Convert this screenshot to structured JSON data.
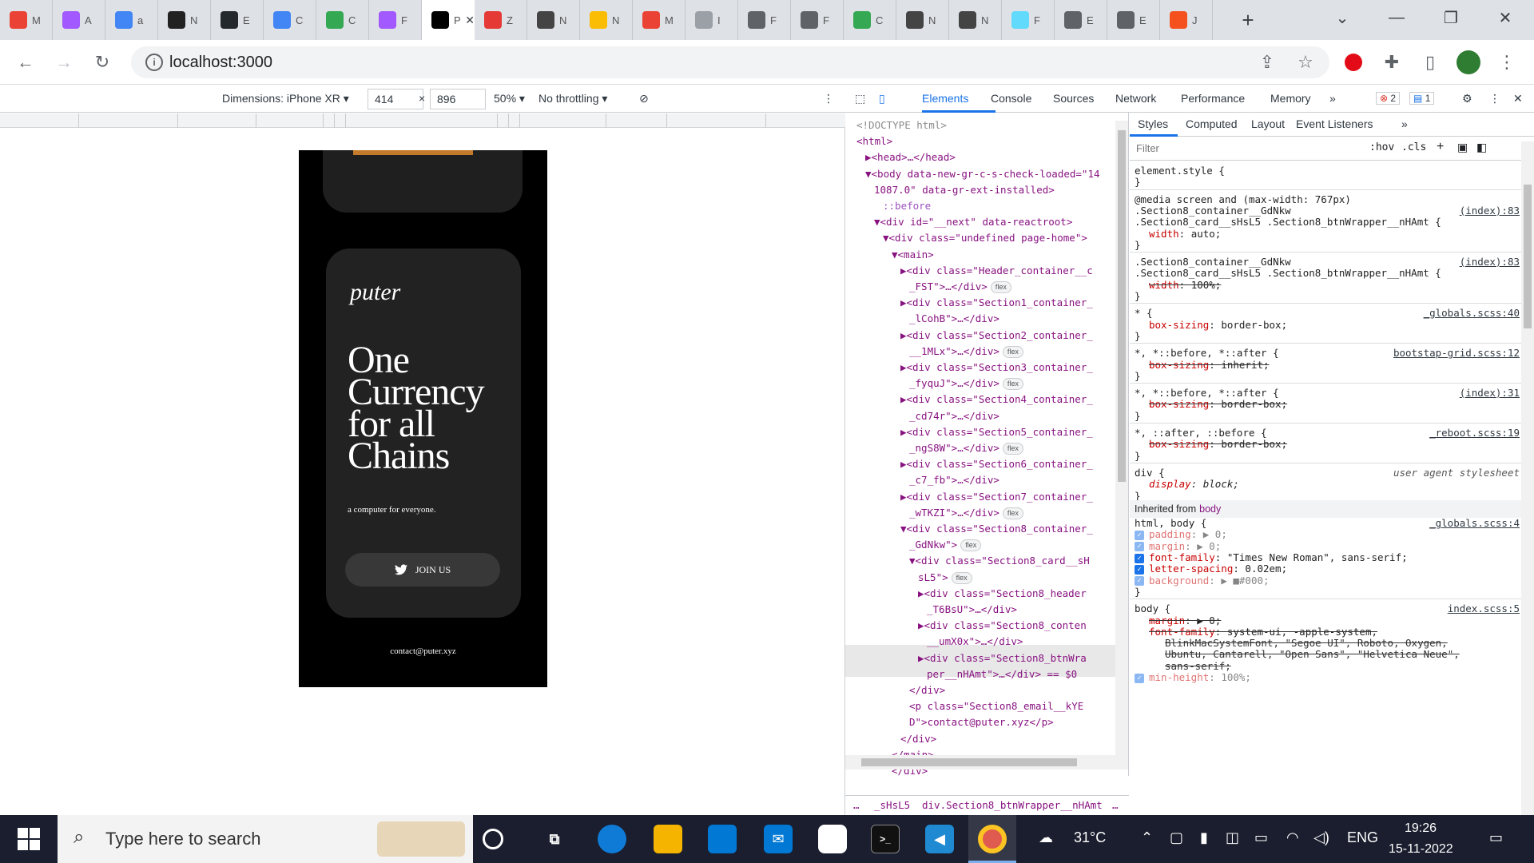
{
  "browser": {
    "tabs": [
      {
        "letter": "M",
        "color": "#ea4335"
      },
      {
        "letter": "A",
        "color": "#a259ff"
      },
      {
        "letter": "a",
        "color": "#4285f4"
      },
      {
        "letter": "N",
        "color": "#222222"
      },
      {
        "letter": "E",
        "color": "#24292e"
      },
      {
        "letter": "C",
        "color": "#4285f4"
      },
      {
        "letter": "C",
        "color": "#34a853"
      },
      {
        "letter": "F",
        "color": "#a259ff"
      },
      {
        "letter": "P",
        "color": "#000000",
        "active": true
      },
      {
        "letter": "Z",
        "color": "#e53935"
      },
      {
        "letter": "N",
        "color": "#444444"
      },
      {
        "letter": "N",
        "color": "#fbbc04"
      },
      {
        "letter": "M",
        "color": "#ea4335"
      },
      {
        "letter": "I",
        "color": "#9aa0a6"
      },
      {
        "letter": "F",
        "color": "#5f6368"
      },
      {
        "letter": "F",
        "color": "#5f6368"
      },
      {
        "letter": "C",
        "color": "#34a853"
      },
      {
        "letter": "N",
        "color": "#444444"
      },
      {
        "letter": "N",
        "color": "#444444"
      },
      {
        "letter": "F",
        "color": "#61dafb"
      },
      {
        "letter": "E",
        "color": "#5f6368"
      },
      {
        "letter": "E",
        "color": "#5f6368"
      },
      {
        "letter": "J",
        "color": "#f4511e"
      }
    ],
    "active_tab_letter": "P",
    "url": "localhost:3000"
  },
  "device_toolbar": {
    "dimensions_label": "Dimensions: iPhone XR",
    "width": "414",
    "times": "×",
    "height": "896",
    "zoom": "50%",
    "throttling": "No throttling"
  },
  "site": {
    "logo": "puter",
    "headline": "One Currency for all Chains",
    "tagline": "a computer for everyone.",
    "join_label": "JOIN US",
    "contact": "contact@puter.xyz"
  },
  "devtools": {
    "tabs": [
      "Elements",
      "Console",
      "Sources",
      "Network",
      "Performance",
      "Memory"
    ],
    "more": "»",
    "errors": "2",
    "messages": "1",
    "styles_tabs": [
      "Styles",
      "Computed",
      "Layout",
      "Event Listeners"
    ],
    "filter_placeholder": "Filter",
    "hov": ":hov",
    "cls": ".cls",
    "breadcrumbs": [
      "…",
      "_sHsL5",
      "div.Section8_btnWrapper__nHAmt",
      "…"
    ],
    "dom": [
      {
        "indent": 0,
        "text": "<!DOCTYPE html>",
        "cls": "cm"
      },
      {
        "indent": 0,
        "text": "<html>"
      },
      {
        "indent": 1,
        "text": "▶<head>…</head>"
      },
      {
        "indent": 1,
        "text": "▼<body data-new-gr-c-s-check-loaded=\"14"
      },
      {
        "indent": 2,
        "text": "1087.0\" data-gr-ext-installed>"
      },
      {
        "indent": 3,
        "text": "::before",
        "cls": "pseudo"
      },
      {
        "indent": 2,
        "text": "▼<div id=\"__next\" data-reactroot>"
      },
      {
        "indent": 3,
        "text": "▼<div class=\"undefined page-home\">"
      },
      {
        "indent": 4,
        "text": "▼<main>"
      },
      {
        "indent": 5,
        "text": "▶<div class=\"Header_container__c"
      },
      {
        "indent": 6,
        "text": "_FST\">…</div>",
        "badge": "flex"
      },
      {
        "indent": 5,
        "text": "▶<div class=\"Section1_container_"
      },
      {
        "indent": 6,
        "text": "_lCohB\">…</div>"
      },
      {
        "indent": 5,
        "text": "▶<div class=\"Section2_container_"
      },
      {
        "indent": 6,
        "text": "__1MLx\">…</div>",
        "badge": "flex"
      },
      {
        "indent": 5,
        "text": "▶<div class=\"Section3_container_"
      },
      {
        "indent": 6,
        "text": "_fyquJ\">…</div>",
        "badge": "flex"
      },
      {
        "indent": 5,
        "text": "▶<div class=\"Section4_container_"
      },
      {
        "indent": 6,
        "text": "_cd74r\">…</div>"
      },
      {
        "indent": 5,
        "text": "▶<div class=\"Section5_container_"
      },
      {
        "indent": 6,
        "text": "_ngS8W\">…</div>",
        "badge": "flex"
      },
      {
        "indent": 5,
        "text": "▶<div class=\"Section6_container_"
      },
      {
        "indent": 6,
        "text": "_c7_fb\">…</div>"
      },
      {
        "indent": 5,
        "text": "▶<div class=\"Section7_container_"
      },
      {
        "indent": 6,
        "text": "_wTKZI\">…</div>",
        "badge": "flex"
      },
      {
        "indent": 5,
        "text": "▼<div class=\"Section8_container_"
      },
      {
        "indent": 6,
        "text": "_GdNkw\">",
        "badge": "flex"
      },
      {
        "indent": 6,
        "text": "▼<div class=\"Section8_card__sH"
      },
      {
        "indent": 7,
        "text": "sL5\">",
        "badge": "flex"
      },
      {
        "indent": 7,
        "text": "▶<div class=\"Section8_header"
      },
      {
        "indent": 8,
        "text": "_T6BsU\">…</div>"
      },
      {
        "indent": 7,
        "text": "▶<div class=\"Section8_conten"
      },
      {
        "indent": 8,
        "text": "__umX0x\">…</div>"
      },
      {
        "indent": 7,
        "text": "▶<div class=\"Section8_btnWra"
      },
      {
        "indent": 8,
        "text": "per__nHAmt\">…</div> == $0"
      },
      {
        "indent": 6,
        "text": "</div>"
      },
      {
        "indent": 6,
        "text": "<p class=\"Section8_email__kYE"
      },
      {
        "indent": 6,
        "text": "D\">contact@puter.xyz</p>"
      },
      {
        "indent": 5,
        "text": "</div>"
      },
      {
        "indent": 4,
        "text": "</main>"
      },
      {
        "indent": 4,
        "text": "</div>"
      }
    ],
    "styles": [
      {
        "kind": "sel",
        "text": "element.style {"
      },
      {
        "kind": "close",
        "text": "}"
      },
      {
        "kind": "sep"
      },
      {
        "kind": "sel",
        "text": "@media screen and (max-width: 767px)"
      },
      {
        "kind": "selsrc",
        "text": ".Section8_container__GdNkw",
        "src": "(index):83"
      },
      {
        "kind": "sel",
        "text": ".Section8_card__sHsL5 .Section8_btnWrapper__nHAmt {"
      },
      {
        "kind": "prop",
        "name": "width",
        "value": "auto;"
      },
      {
        "kind": "close",
        "text": "}"
      },
      {
        "kind": "sep"
      },
      {
        "kind": "selsrc",
        "text": ".Section8_container__GdNkw",
        "src": "(index):83"
      },
      {
        "kind": "sel",
        "text": ".Section8_card__sHsL5 .Section8_btnWrapper__nHAmt {"
      },
      {
        "kind": "strike",
        "name": "width",
        "value": "100%;"
      },
      {
        "kind": "close",
        "text": "}"
      },
      {
        "kind": "sep"
      },
      {
        "kind": "selsrc",
        "text": "* {",
        "src": "_globals.scss:40"
      },
      {
        "kind": "prop",
        "name": "box-sizing",
        "value": "border-box;"
      },
      {
        "kind": "close",
        "text": "}"
      },
      {
        "kind": "sep"
      },
      {
        "kind": "selsrc",
        "text": "*, *::before, *::after {",
        "src": "bootstap-grid.scss:12"
      },
      {
        "kind": "strike",
        "name": "box-sizing",
        "value": "inherit;"
      },
      {
        "kind": "close",
        "text": "}"
      },
      {
        "kind": "sep"
      },
      {
        "kind": "selsrc",
        "text": "*, *::before, *::after {",
        "src": "(index):31"
      },
      {
        "kind": "strike",
        "name": "box-sizing",
        "value": "border-box;"
      },
      {
        "kind": "close",
        "text": "}"
      },
      {
        "kind": "sep"
      },
      {
        "kind": "selsrc",
        "text": "*, ::after, ::before {",
        "src": "_reboot.scss:19"
      },
      {
        "kind": "strike",
        "name": "box-sizing",
        "value": "border-box;"
      },
      {
        "kind": "close",
        "text": "}"
      },
      {
        "kind": "sep"
      },
      {
        "kind": "selua",
        "text": "div {",
        "src": "user agent stylesheet"
      },
      {
        "kind": "uaprop",
        "name": "display",
        "value": "block;"
      },
      {
        "kind": "close",
        "text": "}"
      },
      {
        "kind": "inherited",
        "text": "Inherited from",
        "tag": "body"
      },
      {
        "kind": "selsrc",
        "text": "html, body {",
        "src": "_globals.scss:4"
      },
      {
        "kind": "dim",
        "name": "padding",
        "value": "▶ 0;"
      },
      {
        "kind": "dim",
        "name": "margin",
        "value": "▶ 0;"
      },
      {
        "kind": "cbprop",
        "name": "font-family",
        "value": "\"Times New Roman\", sans-serif;"
      },
      {
        "kind": "cbprop",
        "name": "letter-spacing",
        "value": "0.02em;"
      },
      {
        "kind": "dim",
        "name": "background",
        "value": "▶ ■#000;"
      },
      {
        "kind": "close",
        "text": "}"
      },
      {
        "kind": "sep"
      },
      {
        "kind": "selsrc",
        "text": "body {",
        "src": "index.scss:5"
      },
      {
        "kind": "strike",
        "name": "margin",
        "value": "▶ 0;"
      },
      {
        "kind": "strike",
        "name": "font-family",
        "value": "system-ui, -apple-system,"
      },
      {
        "kind": "strikecont",
        "text": "BlinkMacSystemFont, \"Segoe UI\", Roboto, Oxygen,"
      },
      {
        "kind": "strikecont",
        "text": "Ubuntu, Cantarell, \"Open Sans\", \"Helvetica Neue\","
      },
      {
        "kind": "strikecont",
        "text": "sans-serif;"
      },
      {
        "kind": "dim",
        "name": "min-height",
        "value": "100%;"
      }
    ]
  },
  "taskbar": {
    "search_placeholder": "Type here to search",
    "temperature": "31°C",
    "language": "ENG",
    "time": "19:26",
    "date": "15-11-2022"
  }
}
